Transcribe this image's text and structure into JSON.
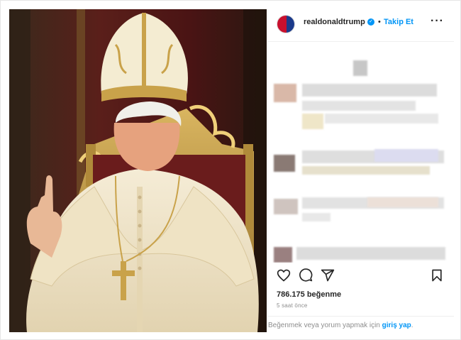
{
  "post": {
    "username": "realdonaldtrump",
    "verified_icon": "verified-badge-icon",
    "separator": "•",
    "follow_label": "Takip Et",
    "more_icon": "more-options-icon",
    "more_glyph": "···",
    "likes": "786.175 beğenme",
    "time_ago": "5 saat önce",
    "footer_text": "Beğenmek veya yorum yapmak için",
    "footer_link": "giriş yap",
    "footer_end": "."
  },
  "actions": [
    "heart-icon",
    "comment-icon",
    "share-icon",
    "bookmark-icon"
  ],
  "colors": {
    "accent": "#0095f6",
    "muted": "#8e8e8e",
    "text": "#262626",
    "border": "#efefef"
  }
}
